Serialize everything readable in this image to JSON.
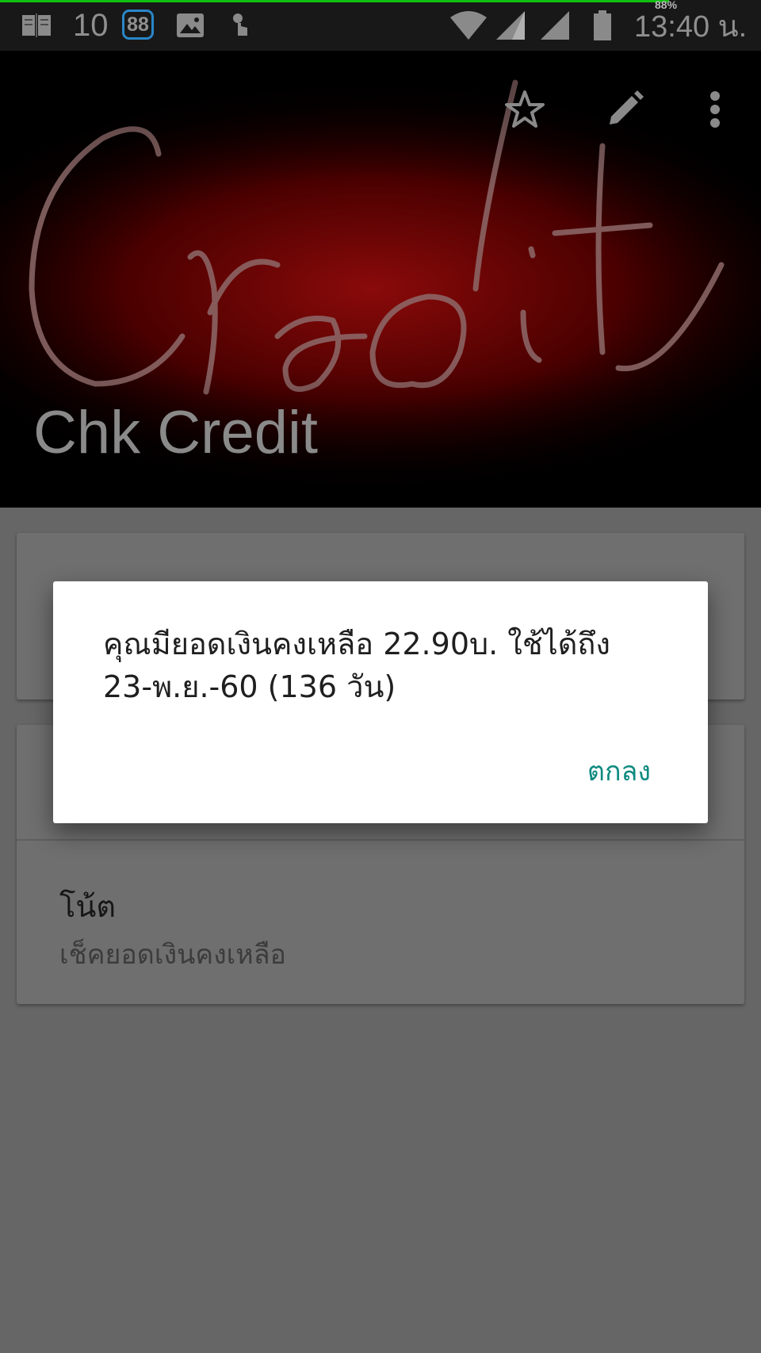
{
  "status_bar": {
    "notification_count": "10",
    "badge": "88",
    "battery_percent": "88%",
    "time": "13:40 น."
  },
  "header": {
    "contact_name": "Chk Credit",
    "image_text": "Credit",
    "icons": [
      "star-outline-icon",
      "edit-pencil-icon",
      "more-vert-icon"
    ]
  },
  "contact": {
    "note_label": "โน้ต",
    "note_value": "เช็คยอดเงินคงเหลือ"
  },
  "dialog": {
    "message_line1": "คุณมียอดเงินคงเหลือ 22.90บ. ใช้ได้ถึง",
    "message_line2": "23-พ.ย.-60 (136 วัน)",
    "ok_label": "ตกลง",
    "accent_color": "#0f8a80"
  }
}
